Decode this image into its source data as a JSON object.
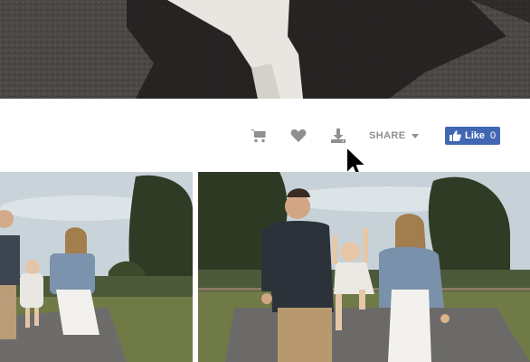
{
  "toolbar": {
    "cart_icon": "shopping-cart-icon",
    "favorite_icon": "heart-icon",
    "download_icon": "download-icon",
    "share_label": "SHARE",
    "share_caret_icon": "caret-down-icon"
  },
  "facebook": {
    "like_label": "Like",
    "like_count": "0",
    "thumb_icon": "thumbs-up-icon",
    "color": "#4267b2"
  },
  "colors": {
    "icon_gray": "#8f8f8f",
    "page_bg": "#ffffff"
  },
  "photos": [
    {
      "kind": "asphalt-shadow-photo"
    },
    {
      "kind": "family-walk-photo-left"
    },
    {
      "kind": "family-walk-photo-right"
    }
  ]
}
